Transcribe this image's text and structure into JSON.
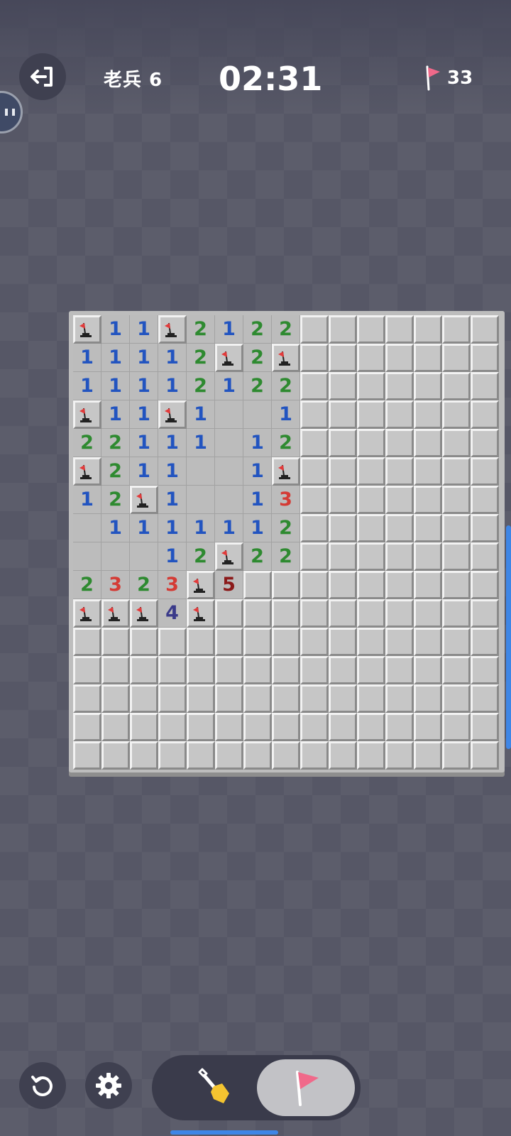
{
  "header": {
    "level_label": "老兵 6",
    "timer": "02:31",
    "flags_remaining": "33"
  },
  "icons": {
    "exit": "exit-icon",
    "flag": "flag-icon",
    "undo": "undo-icon",
    "settings": "gear-icon",
    "shovel": "shovel-icon",
    "mode_flag": "flag-mode-icon"
  },
  "colors": {
    "n1": "#2254c0",
    "n2": "#2e8a30",
    "n3": "#d43b35",
    "n4": "#3a3a8a",
    "n5": "#8b1a1a",
    "flag_red": "#e23a3a"
  },
  "board": {
    "cols": 15,
    "rows": 16,
    "legend": "F = flagged, C = closed, E = empty open, digit = open number",
    "cells": [
      [
        "F",
        "1",
        "1",
        "F",
        "2",
        "1",
        "2",
        "2",
        "C",
        "C",
        "C",
        "C",
        "C",
        "C",
        "C"
      ],
      [
        "1",
        "1",
        "1",
        "1",
        "2",
        "F",
        "2",
        "F",
        "C",
        "C",
        "C",
        "C",
        "C",
        "C",
        "C"
      ],
      [
        "1",
        "1",
        "1",
        "1",
        "2",
        "1",
        "2",
        "2",
        "C",
        "C",
        "C",
        "C",
        "C",
        "C",
        "C"
      ],
      [
        "F",
        "1",
        "1",
        "F",
        "1",
        "E",
        "E",
        "1",
        "C",
        "C",
        "C",
        "C",
        "C",
        "C",
        "C"
      ],
      [
        "2",
        "2",
        "1",
        "1",
        "1",
        "E",
        "1",
        "2",
        "C",
        "C",
        "C",
        "C",
        "C",
        "C",
        "C"
      ],
      [
        "F",
        "2",
        "1",
        "1",
        "E",
        "E",
        "1",
        "F",
        "C",
        "C",
        "C",
        "C",
        "C",
        "C",
        "C"
      ],
      [
        "1",
        "2",
        "F",
        "1",
        "E",
        "E",
        "1",
        "3",
        "C",
        "C",
        "C",
        "C",
        "C",
        "C",
        "C"
      ],
      [
        "E",
        "1",
        "1",
        "1",
        "1",
        "1",
        "1",
        "2",
        "C",
        "C",
        "C",
        "C",
        "C",
        "C",
        "C"
      ],
      [
        "E",
        "E",
        "E",
        "1",
        "2",
        "F",
        "2",
        "2",
        "C",
        "C",
        "C",
        "C",
        "C",
        "C",
        "C"
      ],
      [
        "2",
        "3",
        "2",
        "3",
        "F",
        "5",
        "C",
        "C",
        "C",
        "C",
        "C",
        "C",
        "C",
        "C",
        "C"
      ],
      [
        "F",
        "F",
        "F",
        "4",
        "F",
        "C",
        "C",
        "C",
        "C",
        "C",
        "C",
        "C",
        "C",
        "C",
        "C"
      ],
      [
        "C",
        "C",
        "C",
        "C",
        "C",
        "C",
        "C",
        "C",
        "C",
        "C",
        "C",
        "C",
        "C",
        "C",
        "C"
      ],
      [
        "C",
        "C",
        "C",
        "C",
        "C",
        "C",
        "C",
        "C",
        "C",
        "C",
        "C",
        "C",
        "C",
        "C",
        "C"
      ],
      [
        "C",
        "C",
        "C",
        "C",
        "C",
        "C",
        "C",
        "C",
        "C",
        "C",
        "C",
        "C",
        "C",
        "C",
        "C"
      ],
      [
        "C",
        "C",
        "C",
        "C",
        "C",
        "C",
        "C",
        "C",
        "C",
        "C",
        "C",
        "C",
        "C",
        "C",
        "C"
      ],
      [
        "C",
        "C",
        "C",
        "C",
        "C",
        "C",
        "C",
        "C",
        "C",
        "C",
        "C",
        "C",
        "C",
        "C",
        "C"
      ]
    ]
  }
}
